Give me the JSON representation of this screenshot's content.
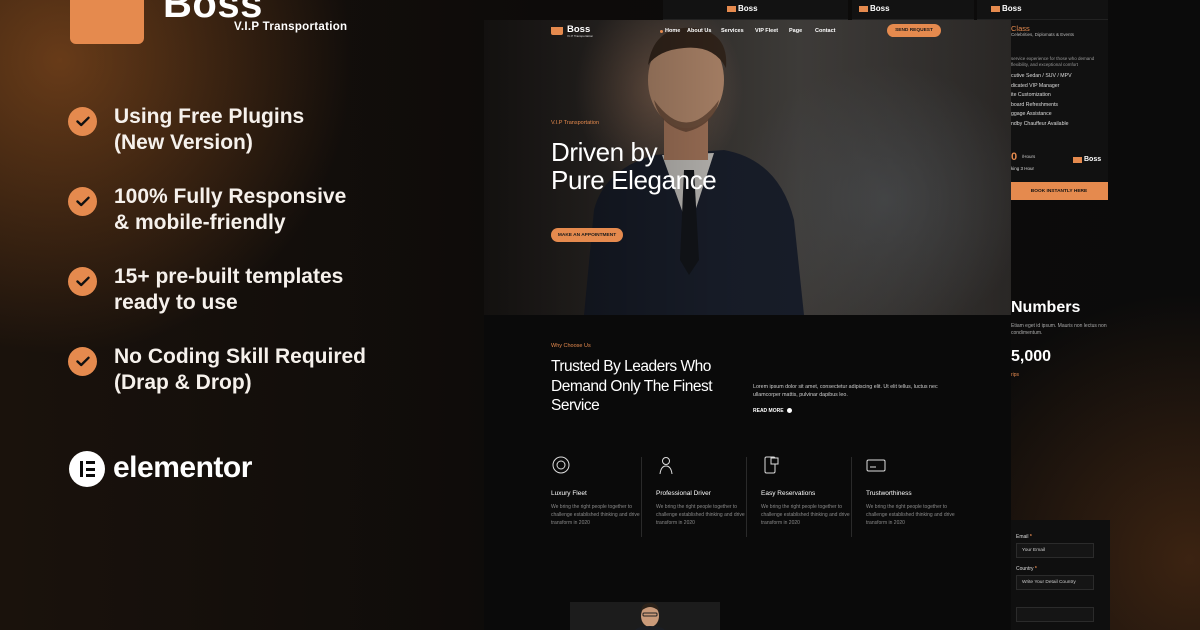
{
  "brand": {
    "name": "Boss",
    "tagline": "V.I.P Transportation"
  },
  "features": [
    {
      "line1": "Using Free Plugins",
      "line2": "(New Version)"
    },
    {
      "line1": "100% Fully Responsive",
      "line2": "& mobile-friendly"
    },
    {
      "line1": "15+ pre-built templates",
      "line2": "ready to use"
    },
    {
      "line1": "No Coding Skill Required",
      "line2": "(Drap & Drop)"
    }
  ],
  "builder": {
    "name": "elementor"
  },
  "accent_color": "#E58A4E",
  "background_color": "#0B0B0B",
  "back_strips": [
    {
      "brand": "Boss"
    },
    {
      "brand": "Boss"
    },
    {
      "brand": "Boss"
    }
  ],
  "service_card": {
    "title": "Class",
    "subtitle": "Celebrities, Diplomats & Events",
    "description": "service experience for those who demand flexibility, and exceptional comfort",
    "items": [
      "cutive Sedan / SUV / MPV",
      "dicated VIP Manager",
      "ite Customization",
      "board Refreshments",
      "ggage Assistance",
      "ndby Chauffeur Available"
    ],
    "price": "0",
    "price_unit": "/Hours",
    "price_note": "king 3 Hour",
    "brand": "Boss",
    "button_label": "BOOK INSTANTLY HERE"
  },
  "numbers_card": {
    "title": "Numbers",
    "text": "Etiam eget id ipsum. Mauris non lectus non condimentum.",
    "count": "5,000",
    "label": "rips"
  },
  "form_card": {
    "email_label": "Email",
    "email_placeholder": "Your Email",
    "country_label": "Country",
    "country_placeholder": "Write Your Detail Country",
    "required_mark": "*"
  },
  "preview": {
    "nav": {
      "brand": "Boss",
      "brand_sub": "V.I.P Transportation",
      "items": [
        "Home",
        "About Us",
        "Services",
        "VIP Fleet",
        "Page",
        "Contact"
      ],
      "cta": "SEND REQUEST"
    },
    "hero": {
      "kicker": "V.I.P Transportation",
      "title_line1": "Driven by",
      "title_line2": "Pure Elegance",
      "button": "MAKE AN APPOINTMENT"
    },
    "why": {
      "kicker": "Why Choose Us",
      "title_line1": "Trusted By Leaders Who",
      "title_line2": "Demand Only The Finest",
      "title_line3": "Service",
      "description": "Lorem ipsum dolor sit amet, consectetur adipiscing elit. Ut elit tellus, luctus nec ullamcorper mattis, pulvinar dapibus leo.",
      "read_more": "READ MORE"
    },
    "features": [
      {
        "icon": "steering-wheel-icon",
        "title": "Luxury Fleet",
        "text": "We bring the right people together to challenge established thinking and drive transform in 2020"
      },
      {
        "icon": "chauffeur-icon",
        "title": "Professional Driver",
        "text": "We bring the right people together to challenge established thinking and drive transform in 2020"
      },
      {
        "icon": "phone-calendar-icon",
        "title": "Easy Reservations",
        "text": "We bring the right people together to challenge established thinking and drive transform in 2020"
      },
      {
        "icon": "card-icon",
        "title": "Trustworthiness",
        "text": "We bring the right people together to challenge established thinking and drive transform in 2020"
      }
    ]
  }
}
